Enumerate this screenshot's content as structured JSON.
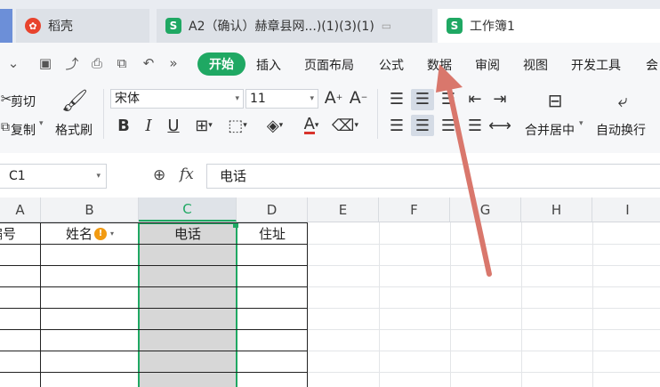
{
  "tabs": [
    {
      "label": "稻壳",
      "logo": "稻"
    },
    {
      "label": "A2（确认）赫章县网...)(1)(3)(1)",
      "logo": "S"
    },
    {
      "label": "工作簿1",
      "logo": "S"
    }
  ],
  "menu": {
    "start": "开始",
    "items": [
      "插入",
      "页面布局",
      "公式",
      "数据",
      "审阅",
      "视图",
      "开发工具",
      "会"
    ]
  },
  "ribbon": {
    "cut": "剪切",
    "copy": "复制",
    "format_painter": "格式刷",
    "font_name": "宋体",
    "font_size": "11",
    "bold": "B",
    "italic": "I",
    "underline": "U",
    "merge_center": "合并居中",
    "wrap_text": "自动换行",
    "font_color_letter": "A"
  },
  "formula_bar": {
    "name_box": "C1",
    "fx": "fx",
    "value": "电话"
  },
  "columns": [
    "A",
    "B",
    "C",
    "D",
    "E",
    "F",
    "G",
    "H",
    "I"
  ],
  "row1": {
    "a": "编号",
    "b": "姓名",
    "c": "电话",
    "d": "住址"
  },
  "colors": {
    "accent": "#1fa863",
    "arrow": "#d9776c",
    "selection": "#d7d7d7"
  }
}
